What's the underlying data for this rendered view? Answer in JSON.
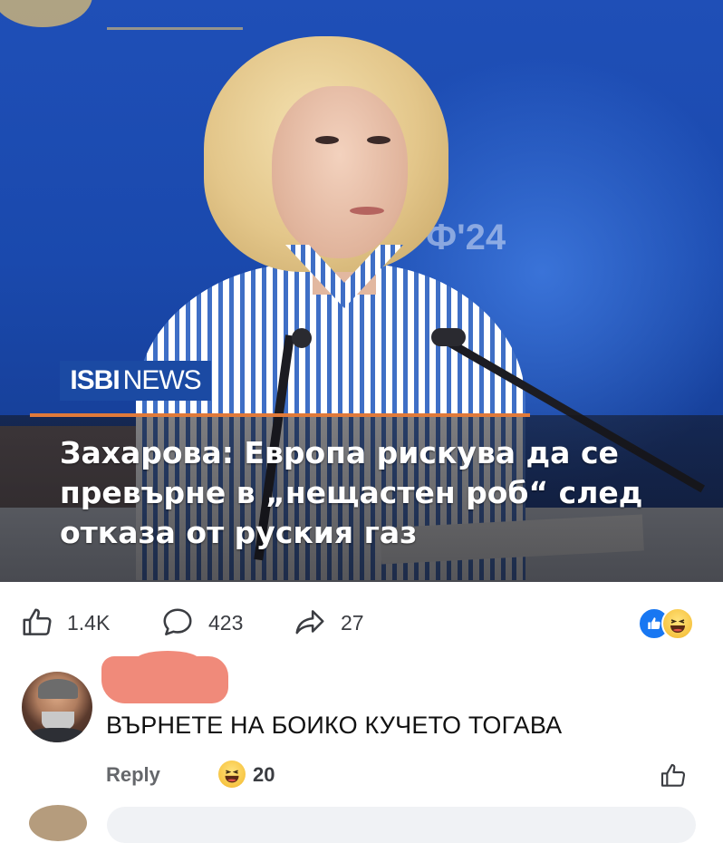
{
  "post": {
    "brand": {
      "bold": "ISBI",
      "light": "NEWS"
    },
    "headline_lines": [
      "Захарова: Европа рискува да се",
      "превърне в „нещастен роб“ след",
      "отказа от руския газ"
    ],
    "background_mark": "Ф'24"
  },
  "stats": {
    "likes": "1.4K",
    "comments": "423",
    "shares": "27",
    "reaction_icons": [
      "like-icon",
      "haha-icon"
    ]
  },
  "comment": {
    "text": "ВЪРНЕТЕ НА БОИКО КУЧЕТО ТОГАВА",
    "reply_label": "Reply",
    "reaction_count": "20",
    "reaction_icon": "haha-icon"
  },
  "colors": {
    "facebook_blue": "#1877f2",
    "brand_blue": "#1b4aa3",
    "accent_orange": "#e07a3a",
    "redaction": "#f08a7a",
    "muted_text": "#65676b"
  }
}
